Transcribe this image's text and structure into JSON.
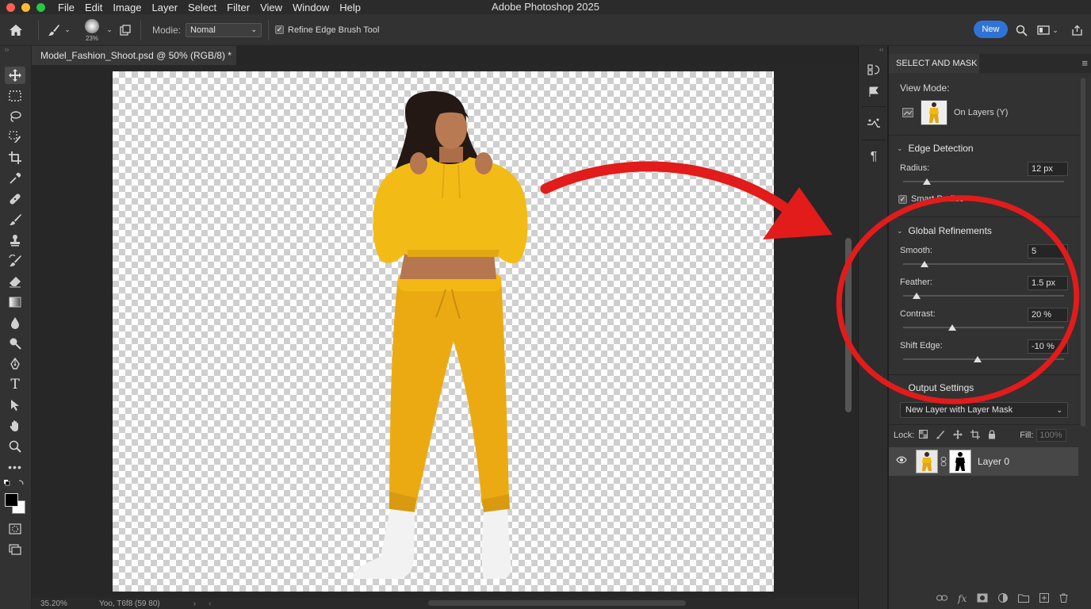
{
  "menubar": {
    "items": [
      "File",
      "Edit",
      "Image",
      "Layer",
      "Select",
      "Filter",
      "View",
      "Window",
      "Help"
    ],
    "title": "Adobe Photoshop 2025"
  },
  "options": {
    "brush_size": "23%",
    "mode_label": "Modie:",
    "mode_value": "Nomal",
    "refine_edge_label": "Refine Edge Brush Tool",
    "new_button": "New"
  },
  "document": {
    "tab_title": "Model_Fashion_Shoot.psd @ 50% (RGB/8) *"
  },
  "status": {
    "zoom": "35.20%",
    "info": "Yoo, T6f8 (59 80)"
  },
  "panel": {
    "title": "SELECT AND MASK",
    "view_mode_label": "View Mode:",
    "view_mode_value": "On Layers (Y)",
    "edge_detection": {
      "title": "Edge Detection",
      "radius_label": "Radius:",
      "radius_value": "12 px",
      "smart_radius_label": "Smart Radius"
    },
    "global_refinements": {
      "title": "Global Refinements",
      "smooth_label": "Smooth:",
      "smooth_value": "5",
      "feather_label": "Feather:",
      "feather_value": "1.5 px",
      "contrast_label": "Contrast:",
      "contrast_value": "20 %",
      "shift_edge_label": "Shift Edge:",
      "shift_edge_value": "-10 %"
    },
    "output_settings": {
      "title": "Output Settings",
      "output_to": "New Layer with Layer Mask"
    },
    "layers": {
      "lock_label": "Lock:",
      "fill_label": "Fill:",
      "fill_value": "100%",
      "layer_name": "Layer 0"
    }
  },
  "colors": {
    "accent": "#2f73d6",
    "annotation": "#e21b1b",
    "hoodie": "#f1b811"
  }
}
